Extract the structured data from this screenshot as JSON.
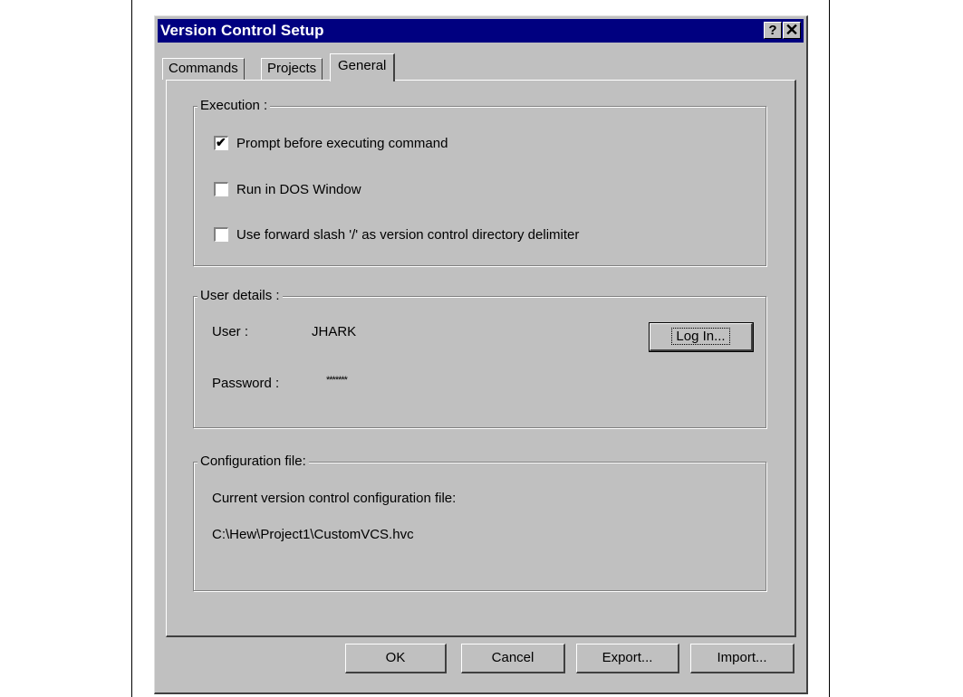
{
  "window": {
    "title": "Version Control Setup",
    "help_glyph": "?",
    "close_glyph": "✕"
  },
  "tabs": [
    {
      "label": "Commands",
      "active": false
    },
    {
      "label": "Projects",
      "active": false
    },
    {
      "label": "General",
      "active": true
    }
  ],
  "execution": {
    "label": "Execution :",
    "options": [
      {
        "label": "Prompt before executing command",
        "checked": true,
        "check_glyph": "✔"
      },
      {
        "label": "Run in DOS Window",
        "checked": false
      },
      {
        "label": "Use forward slash '/' as version control directory delimiter",
        "checked": false
      }
    ]
  },
  "user_details": {
    "label": "User details :",
    "user_label": "User :",
    "user_value": "JHARK",
    "password_label": "Password :",
    "password_value": "*******",
    "login_button": "Log In..."
  },
  "configuration": {
    "label": "Configuration file:",
    "description": "Current version control configuration file:",
    "path": "C:\\Hew\\Project1\\CustomVCS.hvc"
  },
  "buttons": {
    "ok": "OK",
    "cancel": "Cancel",
    "export": "Export...",
    "import": "Import..."
  }
}
